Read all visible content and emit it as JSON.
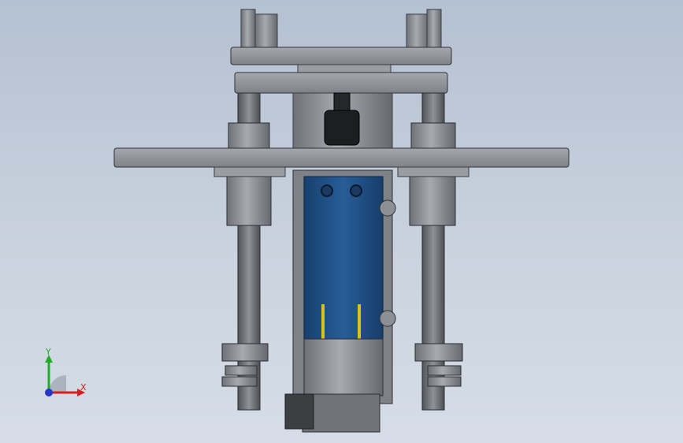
{
  "view": {
    "type": "cad-3d-viewport",
    "background_top": "#b4c1d2",
    "background_bottom": "#d6dde6"
  },
  "model": {
    "palette": {
      "steel": "#8c8f96",
      "steel_dark": "#55585e",
      "steel_light": "#a9acb2",
      "cylinder_blue": "#1f4f86",
      "rod_yellow": "#d9c21a",
      "rubber": "#1c1c1e"
    }
  },
  "triad": {
    "x_label": "X",
    "y_label": "Y",
    "x_color": "#d42020",
    "y_color": "#1fae2a",
    "z_color": "#2436c8"
  }
}
